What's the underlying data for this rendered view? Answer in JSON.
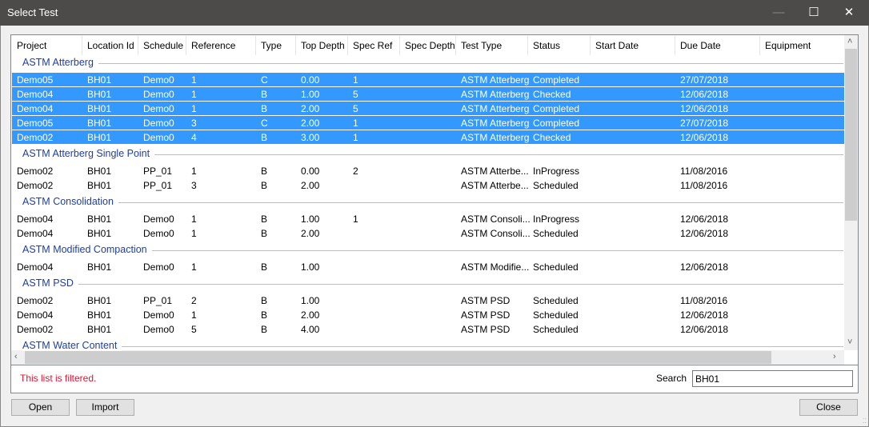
{
  "window": {
    "title": "Select Test",
    "minimize_icon": "minimize-icon",
    "maximize_icon": "maximize-icon",
    "close_icon": "close-icon"
  },
  "columns": [
    "Project",
    "Location Id",
    "Schedule",
    "Reference",
    "Type",
    "Top Depth",
    "Spec Ref",
    "Spec Depth",
    "Test Type",
    "Status",
    "Start Date",
    "Due Date",
    "Equipment"
  ],
  "groups": [
    {
      "name": "ASTM Atterberg",
      "rows": [
        {
          "selected": true,
          "cells": [
            "Demo05",
            "BH01",
            "Demo0",
            "1",
            "C",
            "0.00",
            "1",
            "",
            "ASTM Atterberg",
            "Completed",
            "",
            "27/07/2018",
            ""
          ]
        },
        {
          "selected": true,
          "cells": [
            "Demo04",
            "BH01",
            "Demo0",
            "1",
            "B",
            "1.00",
            "5",
            "",
            "ASTM Atterberg",
            "Checked",
            "",
            "12/06/2018",
            ""
          ]
        },
        {
          "selected": true,
          "cells": [
            "Demo04",
            "BH01",
            "Demo0",
            "1",
            "B",
            "2.00",
            "5",
            "",
            "ASTM Atterberg",
            "Completed",
            "",
            "12/06/2018",
            ""
          ]
        },
        {
          "selected": true,
          "cells": [
            "Demo05",
            "BH01",
            "Demo0",
            "3",
            "C",
            "2.00",
            "1",
            "",
            "ASTM Atterberg",
            "Completed",
            "",
            "27/07/2018",
            ""
          ]
        },
        {
          "selected": true,
          "cells": [
            "Demo02",
            "BH01",
            "Demo0",
            "4",
            "B",
            "3.00",
            "1",
            "",
            "ASTM Atterberg",
            "Checked",
            "",
            "12/06/2018",
            ""
          ]
        }
      ]
    },
    {
      "name": "ASTM Atterberg Single Point",
      "rows": [
        {
          "selected": false,
          "cells": [
            "Demo02",
            "BH01",
            "PP_01",
            "1",
            "B",
            "0.00",
            "2",
            "",
            "ASTM Atterbe...",
            "InProgress",
            "",
            "11/08/2016",
            ""
          ]
        },
        {
          "selected": false,
          "cells": [
            "Demo02",
            "BH01",
            "PP_01",
            "3",
            "B",
            "2.00",
            "",
            "",
            "ASTM Atterbe...",
            "Scheduled",
            "",
            "11/08/2016",
            ""
          ]
        }
      ]
    },
    {
      "name": "ASTM Consolidation",
      "rows": [
        {
          "selected": false,
          "cells": [
            "Demo04",
            "BH01",
            "Demo0",
            "1",
            "B",
            "1.00",
            "1",
            "",
            "ASTM Consoli...",
            "InProgress",
            "",
            "12/06/2018",
            ""
          ]
        },
        {
          "selected": false,
          "cells": [
            "Demo04",
            "BH01",
            "Demo0",
            "1",
            "B",
            "2.00",
            "",
            "",
            "ASTM Consoli...",
            "Scheduled",
            "",
            "12/06/2018",
            ""
          ]
        }
      ]
    },
    {
      "name": "ASTM Modified Compaction",
      "rows": [
        {
          "selected": false,
          "cells": [
            "Demo04",
            "BH01",
            "Demo0",
            "1",
            "B",
            "1.00",
            "",
            "",
            "ASTM Modifie...",
            "Scheduled",
            "",
            "12/06/2018",
            ""
          ]
        }
      ]
    },
    {
      "name": "ASTM PSD",
      "rows": [
        {
          "selected": false,
          "cells": [
            "Demo02",
            "BH01",
            "PP_01",
            "2",
            "B",
            "1.00",
            "",
            "",
            "ASTM PSD",
            "Scheduled",
            "",
            "11/08/2016",
            ""
          ]
        },
        {
          "selected": false,
          "cells": [
            "Demo04",
            "BH01",
            "Demo0",
            "1",
            "B",
            "2.00",
            "",
            "",
            "ASTM PSD",
            "Scheduled",
            "",
            "12/06/2018",
            ""
          ]
        },
        {
          "selected": false,
          "cells": [
            "Demo02",
            "BH01",
            "Demo0",
            "5",
            "B",
            "4.00",
            "",
            "",
            "ASTM PSD",
            "Scheduled",
            "",
            "12/06/2018",
            ""
          ]
        }
      ]
    },
    {
      "name": "ASTM Water Content",
      "rows": []
    }
  ],
  "footer": {
    "filtered_text": "This list is filtered.",
    "search_label": "Search",
    "search_value": "BH01"
  },
  "buttons": {
    "open": "Open",
    "import": "Import",
    "close": "Close"
  },
  "colors": {
    "selection": "#3399ff",
    "group_header": "#1c3ea8",
    "filtered_text": "#e8102e",
    "titlebar": "#4d4b49"
  }
}
